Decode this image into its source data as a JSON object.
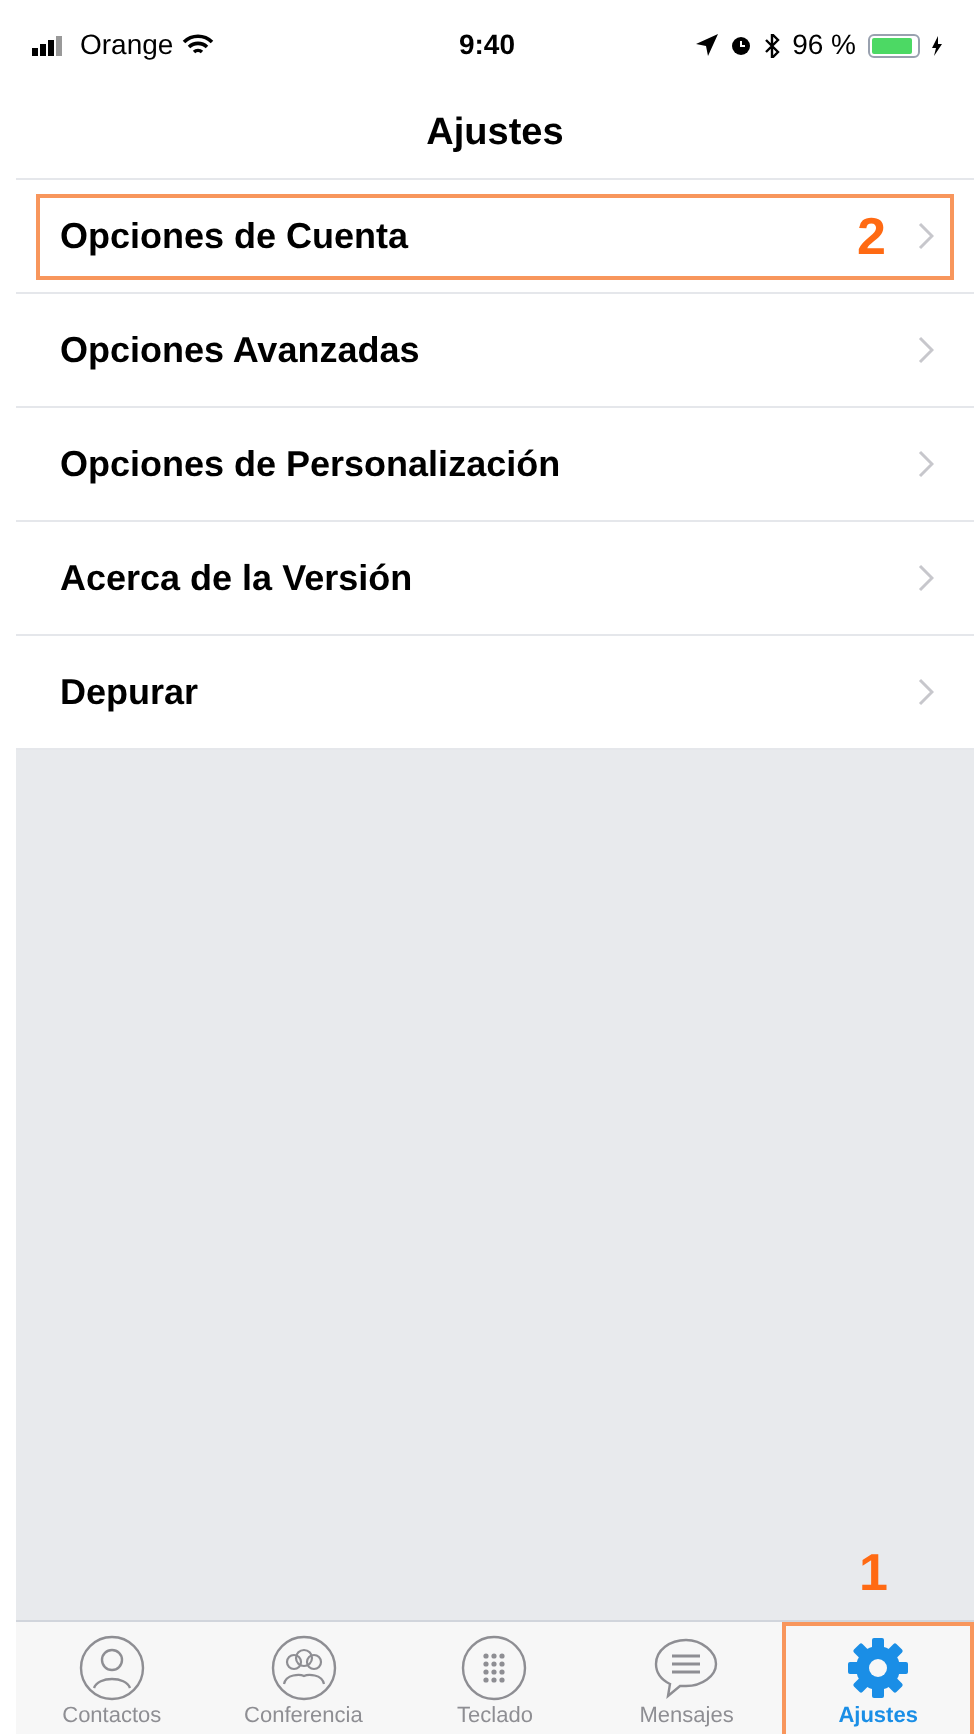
{
  "status_bar": {
    "carrier": "Orange",
    "time": "9:40",
    "battery": "96 %"
  },
  "title": "Ajustes",
  "rows": [
    {
      "label": "Opciones de Cuenta",
      "highlighted": true,
      "marker": "2"
    },
    {
      "label": "Opciones Avanzadas",
      "highlighted": false
    },
    {
      "label": "Opciones de Personalización",
      "highlighted": false
    },
    {
      "label": "Acerca de la Versión",
      "highlighted": false
    },
    {
      "label": "Depurar",
      "highlighted": false
    }
  ],
  "tab_marker": "1",
  "tabs": [
    {
      "label": "Contactos",
      "kind": "person",
      "selected": false,
      "highlighted": false
    },
    {
      "label": "Conferencia",
      "kind": "group",
      "selected": false,
      "highlighted": false
    },
    {
      "label": "Teclado",
      "kind": "keypad",
      "selected": false,
      "highlighted": false
    },
    {
      "label": "Mensajes",
      "kind": "message",
      "selected": false,
      "highlighted": false
    },
    {
      "label": "Ajustes",
      "kind": "gear",
      "selected": true,
      "highlighted": true
    }
  ]
}
